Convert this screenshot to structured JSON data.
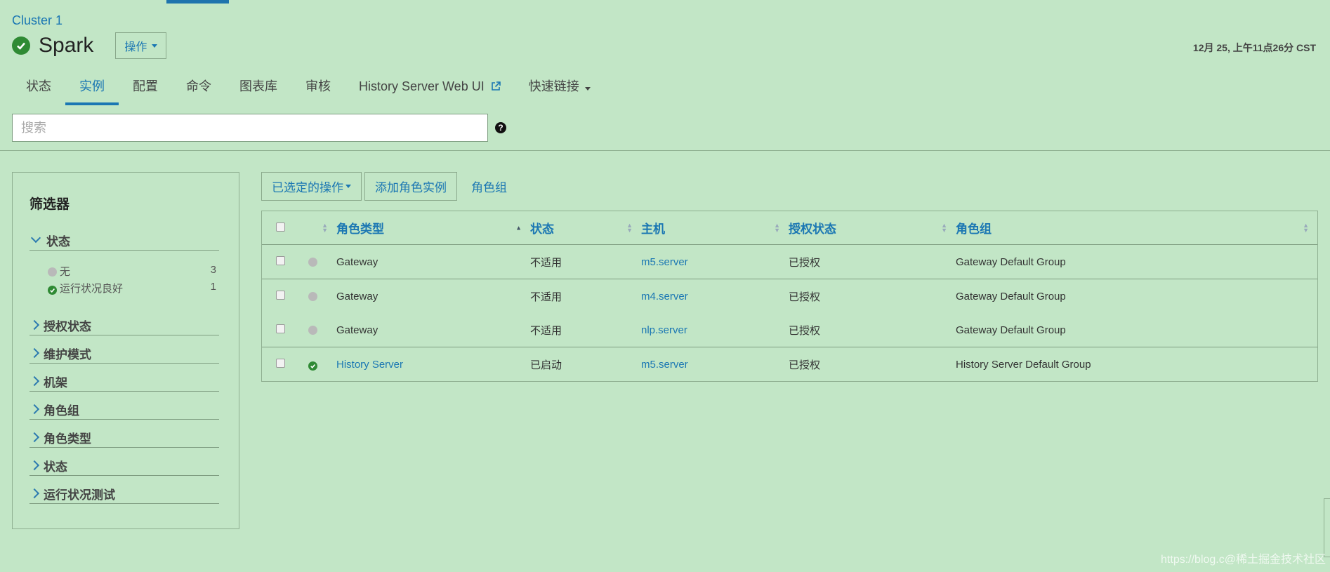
{
  "header": {
    "cluster": "Cluster 1",
    "service": "Spark",
    "ops_label": "操作",
    "timestamp": "12月 25, 上午11点26分 CST"
  },
  "tabs": [
    {
      "label": "状态"
    },
    {
      "label": "实例"
    },
    {
      "label": "配置"
    },
    {
      "label": "命令"
    },
    {
      "label": "图表库"
    },
    {
      "label": "审核"
    },
    {
      "label": "History Server Web UI"
    },
    {
      "label": "快速链接"
    }
  ],
  "search": {
    "placeholder": "搜索"
  },
  "filters": {
    "title": "筛选器",
    "expanded": {
      "label": "状态",
      "items": [
        {
          "label": "无",
          "count": "3"
        },
        {
          "label": "运行状况良好",
          "count": "1"
        }
      ]
    },
    "collapsed": [
      "授权状态",
      "维护模式",
      "机架",
      "角色组",
      "角色类型",
      "状态",
      "运行状况测试"
    ]
  },
  "actions": {
    "selected_ops": "已选定的操作",
    "add_role": "添加角色实例",
    "role_groups": "角色组"
  },
  "table": {
    "headers": [
      "角色类型",
      "状态",
      "主机",
      "授权状态",
      "角色组"
    ],
    "rows": [
      {
        "role_type": "Gateway",
        "state": "不适用",
        "host": "m5.server",
        "auth": "已授权",
        "group": "Gateway Default Group",
        "health": "none"
      },
      {
        "role_type": "Gateway",
        "state": "不适用",
        "host": "m4.server",
        "auth": "已授权",
        "group": "Gateway Default Group",
        "health": "none"
      },
      {
        "role_type": "Gateway",
        "state": "不适用",
        "host": "nlp.server",
        "auth": "已授权",
        "group": "Gateway Default Group",
        "health": "none"
      },
      {
        "role_type": "History Server",
        "state": "已启动",
        "host": "m5.server",
        "auth": "已授权",
        "group": "History Server Default Group",
        "health": "good"
      }
    ]
  },
  "watermark": "https://blog.c@稀土掘金技术社区",
  "colors": {
    "accent": "#1b77b3",
    "background": "#c2e6c6",
    "ok": "#2f8a34"
  }
}
